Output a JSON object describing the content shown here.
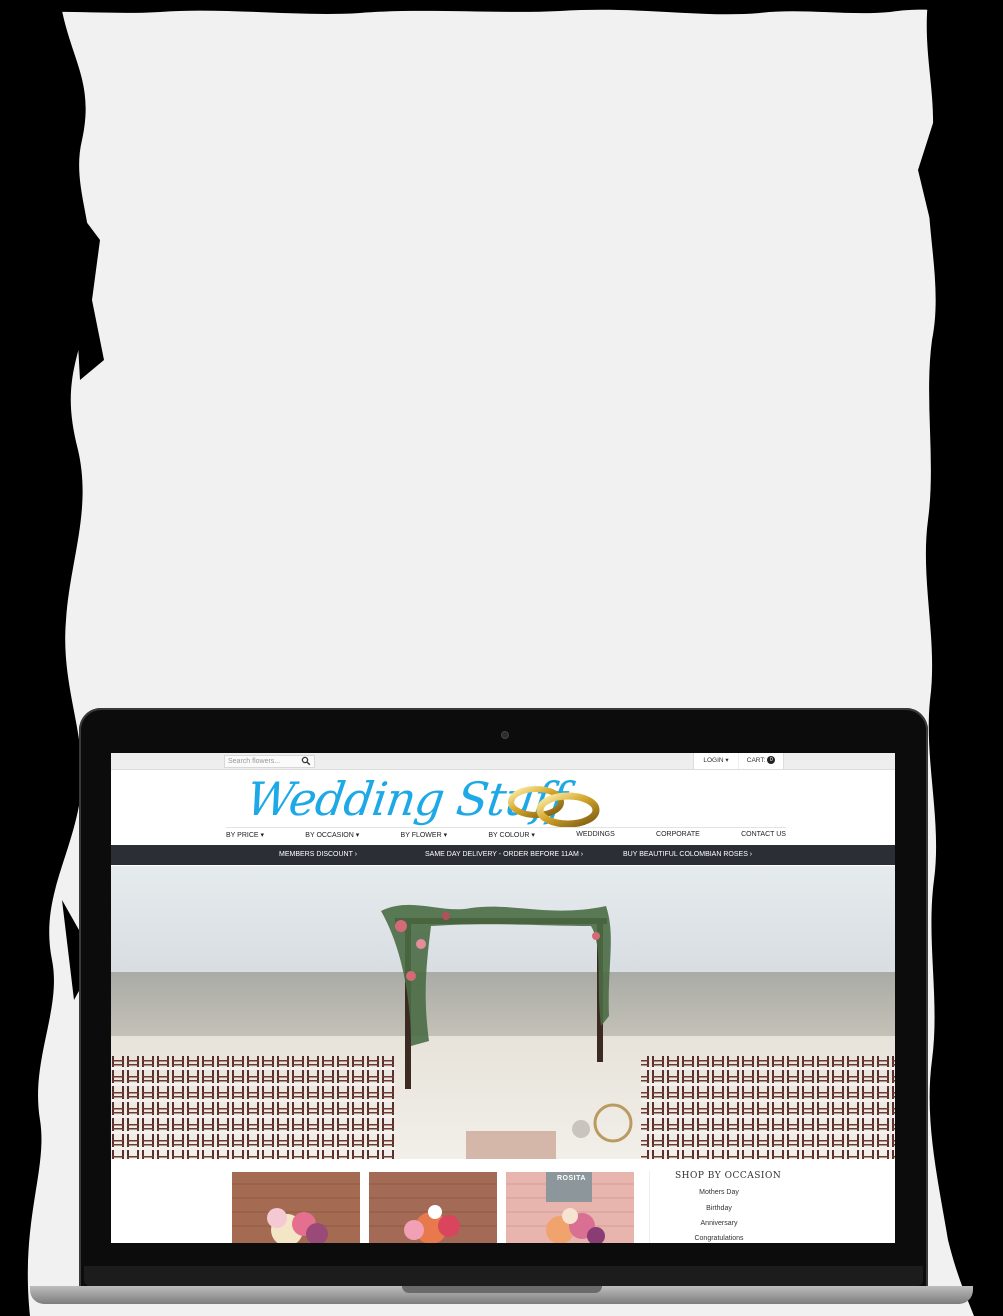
{
  "topbar": {
    "search_placeholder": "Search flowers...",
    "login_label": "LOGIN ▾",
    "cart_label": "CART:",
    "cart_count": "0"
  },
  "logo": {
    "text": "Wedding Stuff"
  },
  "nav": {
    "items": [
      "BY PRICE ▾",
      "BY OCCASION ▾",
      "BY FLOWER ▾",
      "BY COLOUR ▾",
      "WEDDINGS",
      "CORPORATE",
      "CONTACT US"
    ]
  },
  "promo": {
    "items": [
      "MEMBERS DISCOUNT  ›",
      "SAME DAY DELIVERY - ORDER BEFORE 11AM  ›",
      "BUY BEAUTIFUL COLOMBIAN ROSES  ›"
    ]
  },
  "occasions": {
    "title": "SHOP BY OCCASION",
    "items": [
      "Mothers Day",
      "Birthday",
      "Anniversary",
      "Congratulations"
    ]
  },
  "product_tags": {
    "rosita": "ROSITA"
  },
  "icons": [
    "search-icon",
    "wedding-rings-icon",
    "camera-icon"
  ]
}
